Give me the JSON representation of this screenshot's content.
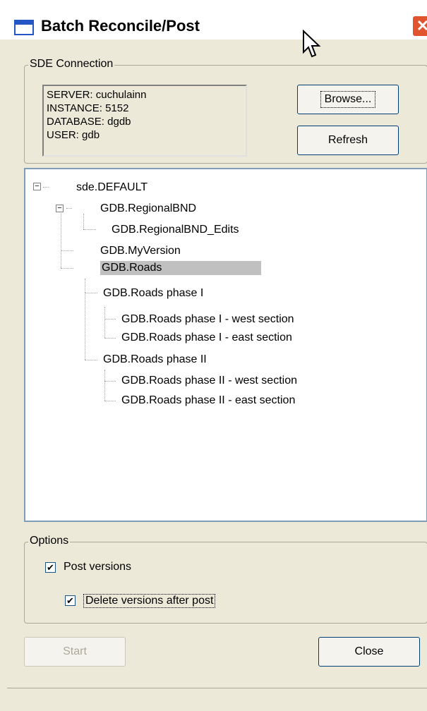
{
  "window": {
    "title": "Batch Reconcile/Post",
    "close_glyph": "✕"
  },
  "sde": {
    "group_label": "SDE Connection",
    "lines": [
      "SERVER: cuchulainn",
      "INSTANCE: 5152",
      "DATABASE: dgdb",
      "USER: gdb"
    ],
    "browse_label": "Browse...",
    "refresh_label": "Refresh"
  },
  "tree": {
    "expander_glyph": "−",
    "items": [
      {
        "label": "sde.DEFAULT",
        "selected": false
      },
      {
        "label": "GDB.RegionalBND",
        "selected": false
      },
      {
        "label": "GDB.RegionalBND_Edits",
        "selected": false
      },
      {
        "label": "GDB.MyVersion",
        "selected": false
      },
      {
        "label": "GDB.Roads",
        "selected": true
      },
      {
        "label": "GDB.Roads phase I",
        "selected": false
      },
      {
        "label": "GDB.Roads phase I - west section",
        "selected": false
      },
      {
        "label": "GDB.Roads phase I - east section",
        "selected": false
      },
      {
        "label": "GDB.Roads phase II",
        "selected": false
      },
      {
        "label": "GDB.Roads phase II - west section",
        "selected": false
      },
      {
        "label": "GDB.Roads phase II - east section",
        "selected": false
      }
    ]
  },
  "options": {
    "group_label": "Options",
    "post_versions": {
      "label": "Post versions",
      "checked": true
    },
    "delete_versions": {
      "label": "Delete versions after post",
      "checked": true
    },
    "check_glyph": "✔"
  },
  "buttons": {
    "start_label": "Start",
    "close_label": "Close"
  },
  "colors": {
    "window_bg": "#ece9d8",
    "selection": "#c0c0c0",
    "tree_border": "#7f9db9"
  }
}
